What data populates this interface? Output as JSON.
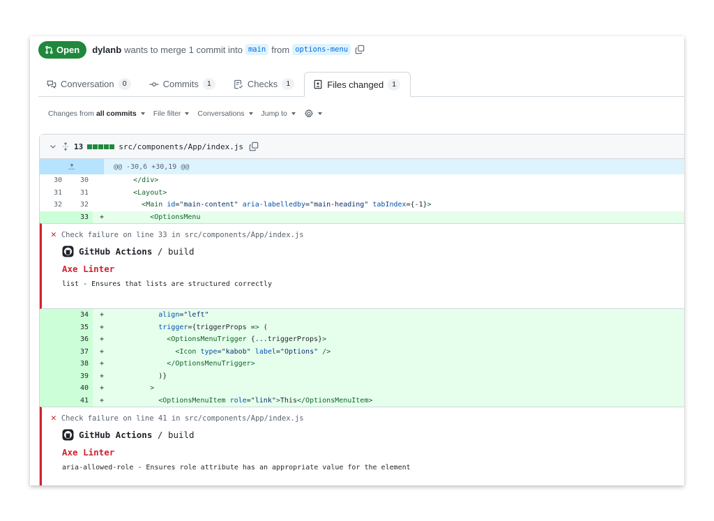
{
  "pr": {
    "state": "Open",
    "author": "dylanb",
    "merge_text": "wants to merge 1 commit into",
    "base_branch": "main",
    "from_text": "from",
    "head_branch": "options-menu",
    "copy_icon": "copy-icon",
    "state_icon": "git-pull-request-icon"
  },
  "tabs": [
    {
      "label": "Conversation",
      "count": "0",
      "icon": "comment-discussion-icon",
      "selected": false
    },
    {
      "label": "Commits",
      "count": "1",
      "icon": "git-commit-icon",
      "selected": false
    },
    {
      "label": "Checks",
      "count": "1",
      "icon": "checklist-icon",
      "selected": false
    },
    {
      "label": "Files changed",
      "count": "1",
      "icon": "file-diff-icon",
      "selected": true
    }
  ],
  "toolbar": {
    "changes_prefix": "Changes from",
    "changes_value": "all commits",
    "file_filter": "File filter",
    "conversations": "Conversations",
    "jump_to": "Jump to",
    "settings_icon": "gear-icon"
  },
  "file": {
    "changes": "13",
    "path": "src/components/App/index.js",
    "diffstat": {
      "additions_blocks": 5,
      "deletions_blocks": 0
    }
  },
  "hunk": "@@ -30,6 +30,19 @@",
  "lines_block1": [
    {
      "type": "ctx",
      "old": "30",
      "new": "30",
      "sign": "",
      "code": "      </div>"
    },
    {
      "type": "ctx",
      "old": "31",
      "new": "31",
      "sign": "",
      "code": "      <Layout>"
    },
    {
      "type": "ctx",
      "old": "32",
      "new": "32",
      "sign": "",
      "code": "        <Main id=\"main-content\" aria-labelledby=\"main-heading\" tabIndex={-1}>"
    },
    {
      "type": "add",
      "old": "",
      "new": "33",
      "sign": "+",
      "code": "          <OptionsMenu"
    }
  ],
  "lines_block2": [
    {
      "type": "add",
      "old": "",
      "new": "34",
      "sign": "+",
      "code": "            align=\"left\""
    },
    {
      "type": "add",
      "old": "",
      "new": "35",
      "sign": "+",
      "code": "            trigger={triggerProps => ("
    },
    {
      "type": "add",
      "old": "",
      "new": "36",
      "sign": "+",
      "code": "              <OptionsMenuTrigger {...triggerProps}>"
    },
    {
      "type": "add",
      "old": "",
      "new": "37",
      "sign": "+",
      "code": "                <Icon type=\"kabob\" label=\"Options\" />"
    },
    {
      "type": "add",
      "old": "",
      "new": "38",
      "sign": "+",
      "code": "              </OptionsMenuTrigger>"
    },
    {
      "type": "add",
      "old": "",
      "new": "39",
      "sign": "+",
      "code": "            )}"
    },
    {
      "type": "add",
      "old": "",
      "new": "40",
      "sign": "+",
      "code": "          >"
    },
    {
      "type": "add",
      "old": "",
      "new": "41",
      "sign": "+",
      "code": "            <OptionsMenuItem role=\"link\">This</OptionsMenuItem>"
    }
  ],
  "annotations": [
    {
      "title": "Check failure on line 33 in src/components/App/index.js",
      "app": "GitHub Actions",
      "job": "/ build",
      "name": "Axe Linter",
      "message": "list - Ensures that lists are structured correctly"
    },
    {
      "title": "Check failure on line 41 in src/components/App/index.js",
      "app": "GitHub Actions",
      "job": "/ build",
      "name": "Axe Linter",
      "message": "aria-allowed-role - Ensures role attribute has an appropriate value for the element"
    }
  ],
  "colors": {
    "open_green": "#1f883d",
    "failure_red": "#cf222e",
    "addition_bg": "#e6ffec",
    "addition_gutter": "#ccffd8",
    "hunk_bg": "#ddf4ff",
    "branch_blue": "#0969da"
  }
}
